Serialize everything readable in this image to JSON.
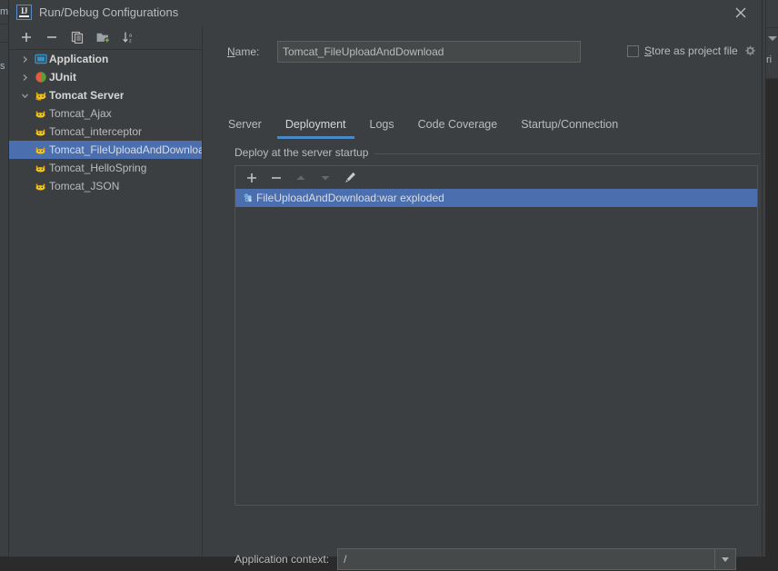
{
  "background": {
    "left_fragments": [
      "m",
      "s"
    ],
    "right_fragments": [
      "ri"
    ]
  },
  "dialog": {
    "title": "Run/Debug Configurations",
    "app_icon": "intellij-idea-icon",
    "close_icon": "close-icon"
  },
  "tree_toolbar": {
    "buttons": [
      {
        "name": "add-configuration-button",
        "icon": "plus-icon",
        "label": "+"
      },
      {
        "name": "remove-configuration-button",
        "icon": "minus-icon",
        "label": "−"
      },
      {
        "name": "copy-configuration-button",
        "icon": "copy-icon",
        "label": "Copy"
      },
      {
        "name": "new-folder-button",
        "icon": "folder-add-icon",
        "label": "New Folder"
      },
      {
        "name": "sort-configurations-button",
        "icon": "sort-alphabetical-icon",
        "label": "Sort"
      }
    ]
  },
  "tree": {
    "items": [
      {
        "label": "Application",
        "icon": "application-icon",
        "expanded": false,
        "group": true,
        "indent": 0,
        "selected": false
      },
      {
        "label": "JUnit",
        "icon": "junit-icon",
        "expanded": false,
        "group": true,
        "indent": 0,
        "selected": false
      },
      {
        "label": "Tomcat Server",
        "icon": "tomcat-icon",
        "expanded": true,
        "group": true,
        "indent": 0,
        "selected": false
      },
      {
        "label": "Tomcat_Ajax",
        "icon": "tomcat-icon",
        "group": false,
        "indent": 1,
        "selected": false
      },
      {
        "label": "Tomcat_interceptor",
        "icon": "tomcat-icon",
        "group": false,
        "indent": 1,
        "selected": false
      },
      {
        "label": "Tomcat_FileUploadAndDownload",
        "icon": "tomcat-icon",
        "group": false,
        "indent": 1,
        "selected": true
      },
      {
        "label": "Tomcat_HelloSpring",
        "icon": "tomcat-icon",
        "group": false,
        "indent": 1,
        "selected": false
      },
      {
        "label": "Tomcat_JSON",
        "icon": "tomcat-icon",
        "group": false,
        "indent": 1,
        "selected": false
      }
    ]
  },
  "name_field": {
    "label": "Name:",
    "label_mnemonic": "N",
    "value": "Tomcat_FileUploadAndDownload",
    "placeholder": ""
  },
  "store_as_project_file": {
    "label": "Store as project file",
    "label_mnemonic": "S",
    "checked": false,
    "gear_icon": "gear-icon"
  },
  "tabs": {
    "items": [
      {
        "label": "Server",
        "active": false
      },
      {
        "label": "Deployment",
        "active": true
      },
      {
        "label": "Logs",
        "active": false
      },
      {
        "label": "Code Coverage",
        "active": false
      },
      {
        "label": "Startup/Connection",
        "active": false
      }
    ],
    "active_underline_color": "#4a88c7"
  },
  "deployment": {
    "group_title": "Deploy at the server startup",
    "toolbar": [
      {
        "name": "add-artifact-button",
        "icon": "plus-icon",
        "enabled": true
      },
      {
        "name": "remove-artifact-button",
        "icon": "minus-icon",
        "enabled": true
      },
      {
        "name": "move-up-button",
        "icon": "arrow-up-icon",
        "enabled": false
      },
      {
        "name": "move-down-button",
        "icon": "arrow-down-icon",
        "enabled": false
      },
      {
        "name": "edit-artifact-button",
        "icon": "pencil-icon",
        "enabled": true
      }
    ],
    "items": [
      {
        "label": "FileUploadAndDownload:war exploded",
        "icon": "war-artifact-icon",
        "selected": true
      }
    ]
  },
  "application_context": {
    "label": "Application context:",
    "value": "/",
    "dropdown_icon": "chevron-down-icon"
  },
  "colors": {
    "dialog_background": "#3c3f41",
    "editor_background": "#2b2b2b",
    "selection_blue": "#4b6eaf",
    "accent_blue": "#4a88c7",
    "text": "#bbbbbb",
    "border": "#4f5355",
    "input_background": "#45494a"
  }
}
